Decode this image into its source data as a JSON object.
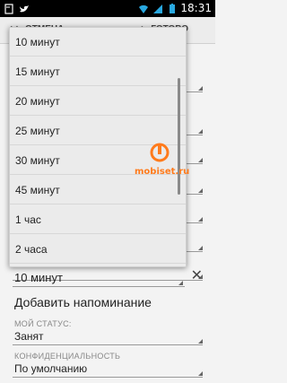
{
  "statusbar": {
    "time": "18:31"
  },
  "actionbar": {
    "cancel_label": "ОТМЕНА",
    "done_label": "ГОТОВО"
  },
  "popup": {
    "items": [
      "10 минут",
      "15 минут",
      "20 минут",
      "25 минут",
      "30 минут",
      "45 минут",
      "1 час",
      "2 часа"
    ]
  },
  "form": {
    "reminder_value": "10 минут",
    "add_reminder": "Добавить напоминание",
    "status_label": "МОЙ СТАТУС:",
    "status_value": "Занят",
    "privacy_label": "КОНФИДЕНЦИАЛЬНОСТЬ",
    "privacy_value": "По умолчанию"
  },
  "watermark": {
    "text": "mobiset.ru"
  },
  "colors": {
    "watermark": "#ff7b1c",
    "statusbar": "#000000"
  }
}
